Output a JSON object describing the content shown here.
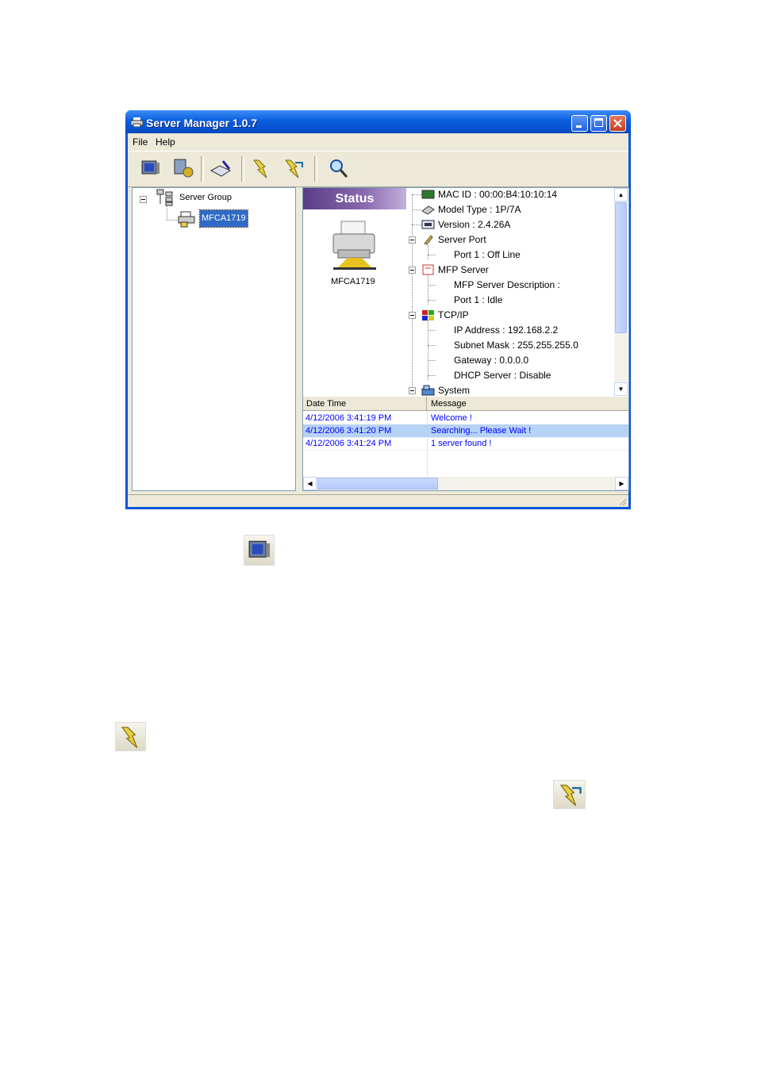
{
  "window": {
    "title": "Server Manager 1.0.7"
  },
  "menu": [
    "File",
    "Help"
  ],
  "toolbar": {
    "icons": [
      "monitor-icon",
      "config-gear-icon",
      "edit-book-icon",
      "lightning-icon",
      "lightning-arrow-icon",
      "search-magnifier-icon"
    ]
  },
  "tree": {
    "root": "Server Group",
    "child": "MFCA1719"
  },
  "status": {
    "header": "Status",
    "device": "MFCA1719",
    "items": {
      "mac": "MAC ID : 00:00:B4:10:10:14",
      "model": "Model Type : 1P/7A",
      "version": "Version : 2.4.26A",
      "server_port": "Server Port",
      "port1_off": "Port 1 : Off Line",
      "mfp_server": "MFP Server",
      "mfp_desc": "MFP Server Description :",
      "port1_idle": "Port 1 : Idle",
      "tcpip": "TCP/IP",
      "ip": "IP Address : 192.168.2.2",
      "subnet": "Subnet Mask : 255.255.255.0",
      "gateway": "Gateway : 0.0.0.0",
      "dhcp": "DHCP Server : Disable",
      "system": "System"
    }
  },
  "log": {
    "headers": [
      "Date Time",
      "Message"
    ],
    "rows": [
      [
        "4/12/2006 3:41:19 PM",
        "Welcome !"
      ],
      [
        "4/12/2006 3:41:20 PM",
        "Searching... Please Wait !"
      ],
      [
        "4/12/2006 3:41:24 PM",
        "1 server found !"
      ]
    ]
  },
  "colors": {
    "titlebar": "#0a5fe0",
    "client": "#ece9d8",
    "selection": "#316ac5",
    "log_text": "#0000ff"
  }
}
